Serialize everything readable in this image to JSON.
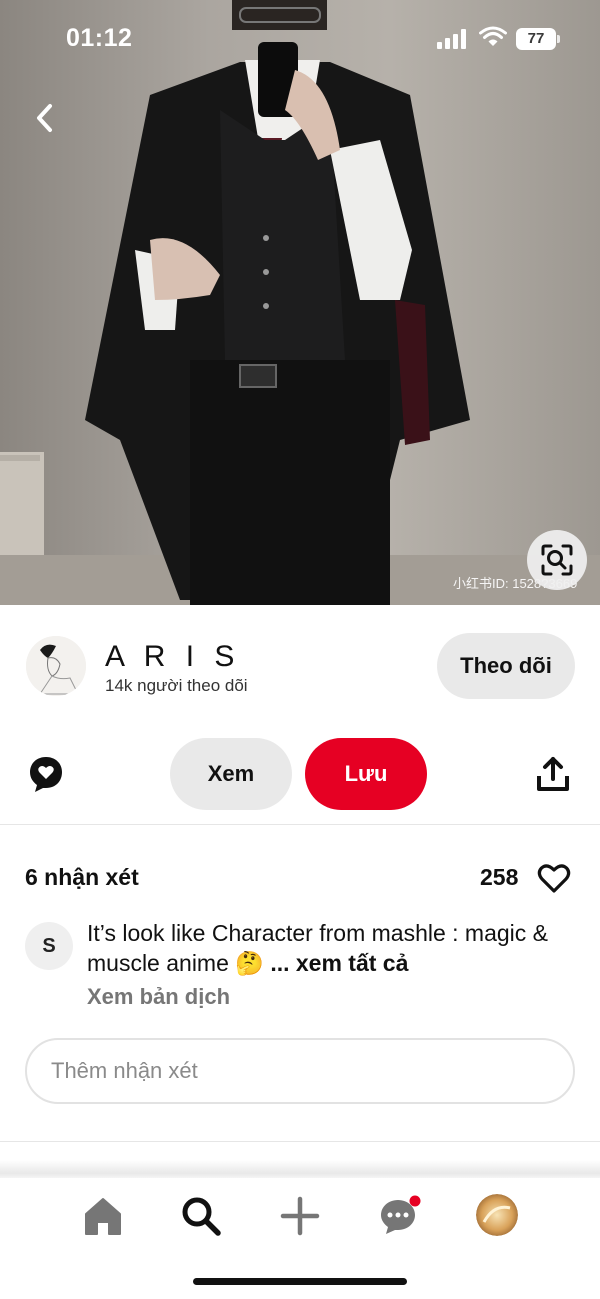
{
  "status_bar": {
    "time": "01:12",
    "battery": "77",
    "icons": [
      "signal-icon",
      "wifi-icon",
      "battery-icon"
    ]
  },
  "hero": {
    "watermark": "小红书ID: 1528?3669",
    "icons": [
      "back-icon",
      "visual-search-icon"
    ]
  },
  "author": {
    "name": "A R I S",
    "followers": "14k người theo dõi",
    "follow_label": "Theo dõi"
  },
  "actions": {
    "view_label": "Xem",
    "save_label": "Lưu",
    "icons": [
      "comment-bubble-icon",
      "share-icon"
    ]
  },
  "comments": {
    "count_label": "6 nhận xét",
    "likes": "258",
    "items": [
      {
        "avatar_letter": "S",
        "text": "It’s look like Character from mashle : magic & muscle anime 🤔",
        "see_all": "... xem tất cả",
        "translate": "Xem bản dịch"
      }
    ],
    "input_placeholder": "Thêm nhận xét"
  },
  "bottom_nav": {
    "items": [
      "home-icon",
      "search-icon",
      "plus-icon",
      "messages-icon",
      "profile-avatar"
    ]
  },
  "colors": {
    "accent": "#e60023",
    "button_gray": "#e9e9e9",
    "notification_dot": "#e60023"
  }
}
